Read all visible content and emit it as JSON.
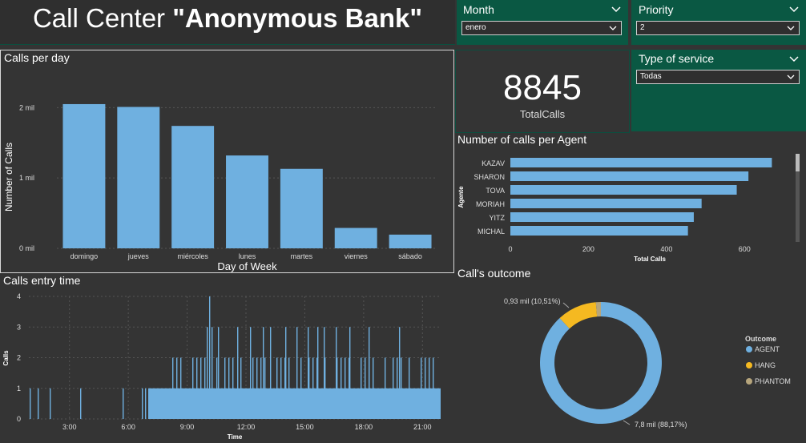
{
  "header": {
    "title_plain": "Call Center ",
    "title_bold": "\"Anonymous Bank\""
  },
  "slicers": {
    "month": {
      "label": "Month",
      "value": "enero"
    },
    "priority": {
      "label": "Priority",
      "value": "2"
    },
    "service": {
      "label": "Type of service",
      "value": "Todas"
    }
  },
  "kpi": {
    "value": "8845",
    "label": "TotalCalls"
  },
  "colors": {
    "bar": "#6fb0e0",
    "hang": "#f5b921",
    "phantom": "#b6a57c",
    "accent_green": "#0a5843"
  },
  "calls_per_day": {
    "title": "Calls per day",
    "chart_data": {
      "type": "bar",
      "categories": [
        "domingo",
        "jueves",
        "miércoles",
        "lunes",
        "martes",
        "viernes",
        "sábado"
      ],
      "values": [
        2050,
        2010,
        1740,
        1320,
        1130,
        290,
        195
      ],
      "xlabel": "Day of Week",
      "ylabel": "Number of Calls",
      "yticks": [
        {
          "v": 0,
          "label": "0 mil"
        },
        {
          "v": 1000,
          "label": "1 mil"
        },
        {
          "v": 2000,
          "label": "2 mil"
        }
      ],
      "ylim": [
        0,
        2300
      ],
      "grid": true
    }
  },
  "calls_per_agent": {
    "title": "Number of calls per Agent",
    "chart_data": {
      "type": "bar",
      "orientation": "horizontal",
      "categories": [
        "KAZAV",
        "SHARON",
        "TOVA",
        "MORIAH",
        "YITZ",
        "MICHAL"
      ],
      "values": [
        670,
        610,
        580,
        490,
        470,
        455
      ],
      "xlabel": "Total Calls",
      "ylabel": "Agente",
      "xticks": [
        0,
        200,
        400,
        600
      ],
      "xlim": [
        0,
        700
      ]
    }
  },
  "calls_entry_time": {
    "title": "Calls entry time",
    "chart_data": {
      "type": "bar",
      "xlabel": "Time",
      "ylabel": "Calls",
      "xticks": [
        "3:00",
        "6:00",
        "9:00",
        "12:00",
        "15:00",
        "18:00",
        "21:00"
      ],
      "yticks": [
        0,
        1,
        2,
        3,
        4
      ],
      "ylim": [
        0,
        4
      ]
    }
  },
  "calls_outcome": {
    "title": "Call's outcome",
    "legend_title": "Outcome",
    "chart_data": {
      "type": "pie",
      "donut": true,
      "slices": [
        {
          "name": "AGENT",
          "value": 88.17,
          "label": "7,8 mil (88,17%)",
          "color": "#6fb0e0"
        },
        {
          "name": "HANG",
          "value": 10.51,
          "label": "0,93 mil (10,51%)",
          "color": "#f5b921"
        },
        {
          "name": "PHANTOM",
          "value": 1.32,
          "label": "",
          "color": "#b6a57c"
        }
      ]
    }
  }
}
